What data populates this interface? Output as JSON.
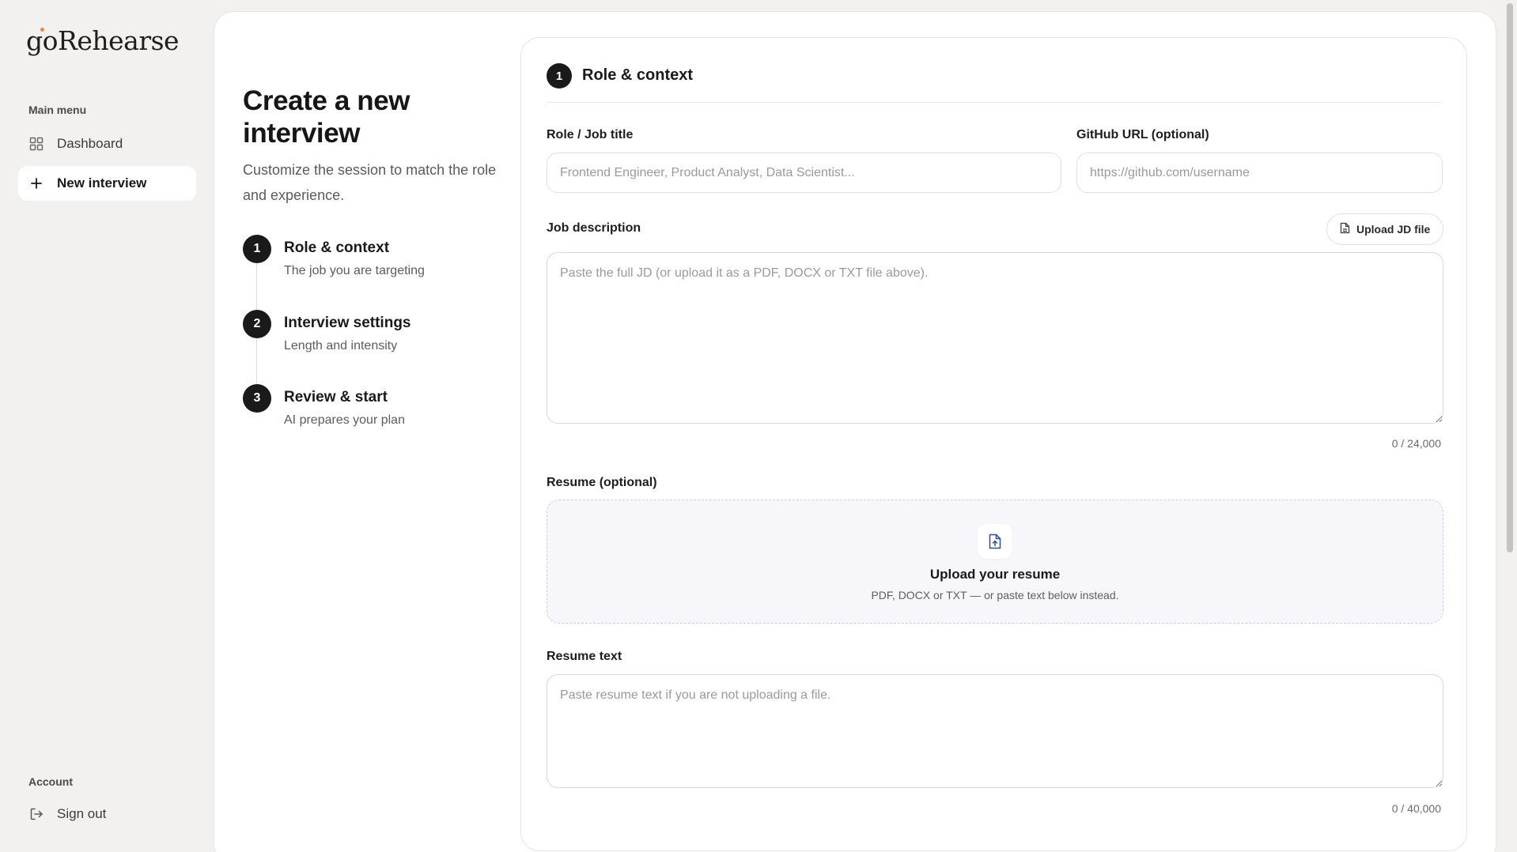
{
  "app": {
    "logo_text": "goRehearse",
    "brand_accent": "#e0894a"
  },
  "sidebar": {
    "main_menu_label": "Main menu",
    "items": [
      {
        "label": "Dashboard",
        "icon": "grid-icon"
      },
      {
        "label": "New interview",
        "icon": "plus-icon",
        "active": true
      }
    ],
    "account_label": "Account",
    "sign_out_label": "Sign out"
  },
  "page": {
    "title": "Create a new interview",
    "subtitle": "Customize the session to match the role and experience."
  },
  "steps": [
    {
      "number": "1",
      "title": "Role & context",
      "desc": "The job you are targeting"
    },
    {
      "number": "2",
      "title": "Interview settings",
      "desc": "Length and intensity"
    },
    {
      "number": "3",
      "title": "Review & start",
      "desc": "AI prepares your plan"
    }
  ],
  "form": {
    "header_number": "1",
    "header_title": "Role & context",
    "role_label": "Role / Job title",
    "role_placeholder": "Frontend Engineer, Product Analyst, Data Scientist...",
    "role_value": "",
    "github_label": "GitHub URL (optional)",
    "github_placeholder": "https://github.com/username",
    "github_value": "",
    "jd_label": "Job description",
    "jd_upload_label": "Upload JD file",
    "jd_placeholder": "Paste the full JD (or upload it as a PDF, DOCX or TXT file above).",
    "jd_value": "",
    "jd_counter": "0 / 24,000",
    "resume_label": "Resume (optional)",
    "resume_upload_title": "Upload your resume",
    "resume_upload_sub": "PDF, DOCX or TXT — or paste text below instead.",
    "resume_text_label": "Resume text",
    "resume_text_placeholder": "Paste resume text if you are not uploading a file.",
    "resume_text_value": "",
    "resume_counter": "0 / 40,000"
  }
}
